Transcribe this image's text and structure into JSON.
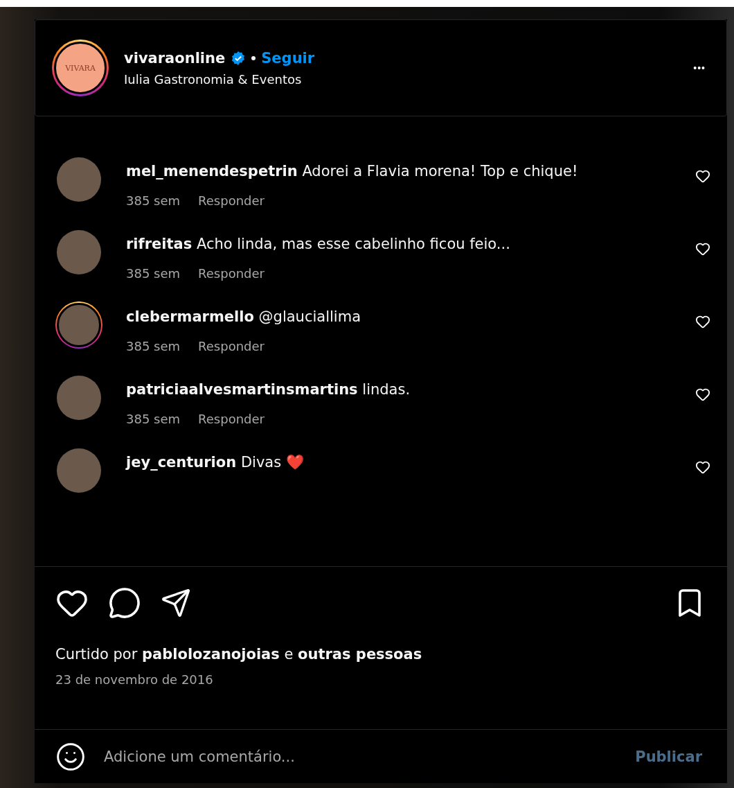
{
  "header": {
    "logo_text": "VIVARA",
    "story_ring": true,
    "username": "vivaraonline",
    "verified": true,
    "follow": "Seguir",
    "location": "Iulia Gastronomia & Eventos",
    "more": "•••"
  },
  "comments": [
    {
      "username": "mel_menendespetrin",
      "text": "Adorei a Flavia morena! Top e chique!",
      "time": "385 sem",
      "reply": "Responder",
      "story_ring": false
    },
    {
      "username": "rifreitas",
      "text": "Acho linda, mas esse cabelinho ficou feio...",
      "time": "385 sem",
      "reply": "Responder",
      "story_ring": false
    },
    {
      "username": "clebermarmello",
      "text": "@glauciallima",
      "time": "385 sem",
      "reply": "Responder",
      "story_ring": true
    },
    {
      "username": "patriciaalvesmartinsmartins",
      "text": "lindas.",
      "time": "385 sem",
      "reply": "Responder",
      "story_ring": false
    },
    {
      "username": "jey_centurion",
      "text": "Divas ❤️",
      "story_ring": false
    }
  ],
  "likes": {
    "prefix": "Curtido por",
    "user": "pablolozanojoias",
    "joiner": "e",
    "others": "outras pessoas"
  },
  "date": "23 de novembro de 2016",
  "composer": {
    "placeholder": "Adicione um comentário...",
    "submit": "Publicar"
  }
}
